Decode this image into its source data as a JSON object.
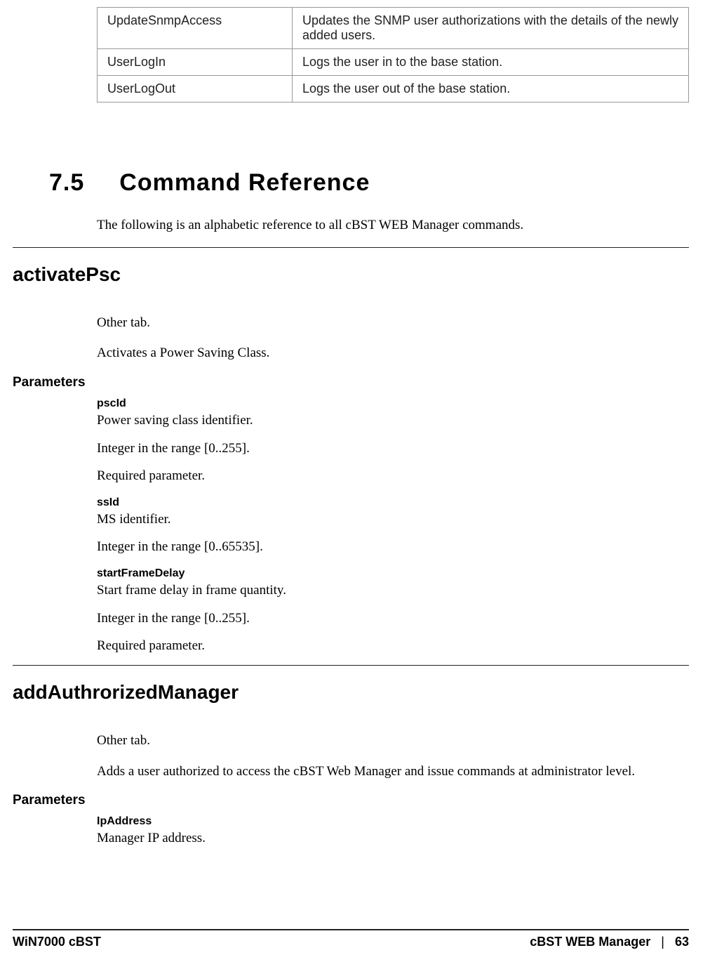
{
  "table": {
    "rows": [
      {
        "name": "UpdateSnmpAccess",
        "desc": "Updates the SNMP user authorizations with the details of the newly added users."
      },
      {
        "name": "UserLogIn",
        "desc": "Logs the user in to the base station."
      },
      {
        "name": "UserLogOut",
        "desc": "Logs the user out of the base station."
      }
    ]
  },
  "section": {
    "num": "7.5",
    "title": "Command Reference",
    "intro": "The following is an alphabetic reference to all cBST WEB Manager commands."
  },
  "cmd1": {
    "name": "activatePsc",
    "tab": "Other tab.",
    "desc": "Activates a Power Saving Class.",
    "params_label": "Parameters",
    "params": {
      "p1_name": "pscId",
      "p1_l1": "Power saving class identifier.",
      "p1_l2": "Integer in the range [0..255].",
      "p1_l3": "Required parameter.",
      "p2_name": "ssId",
      "p2_l1": "MS identifier.",
      "p2_l2": "Integer in the range [0..65535].",
      "p3_name": "startFrameDelay",
      "p3_l1": "Start frame delay in frame quantity.",
      "p3_l2": "Integer in the range [0..255].",
      "p3_l3": "Required parameter."
    }
  },
  "cmd2": {
    "name": "addAuthrorizedManager",
    "tab": "Other tab.",
    "desc": "Adds a user authorized to access the cBST Web Manager and issue commands at administrator level.",
    "params_label": "Parameters",
    "params": {
      "p1_name": "IpAddress",
      "p1_l1": "Manager IP address."
    }
  },
  "footer": {
    "left": "WiN7000 cBST",
    "right_title": "cBST WEB Manager",
    "divider": "|",
    "page": "63"
  }
}
